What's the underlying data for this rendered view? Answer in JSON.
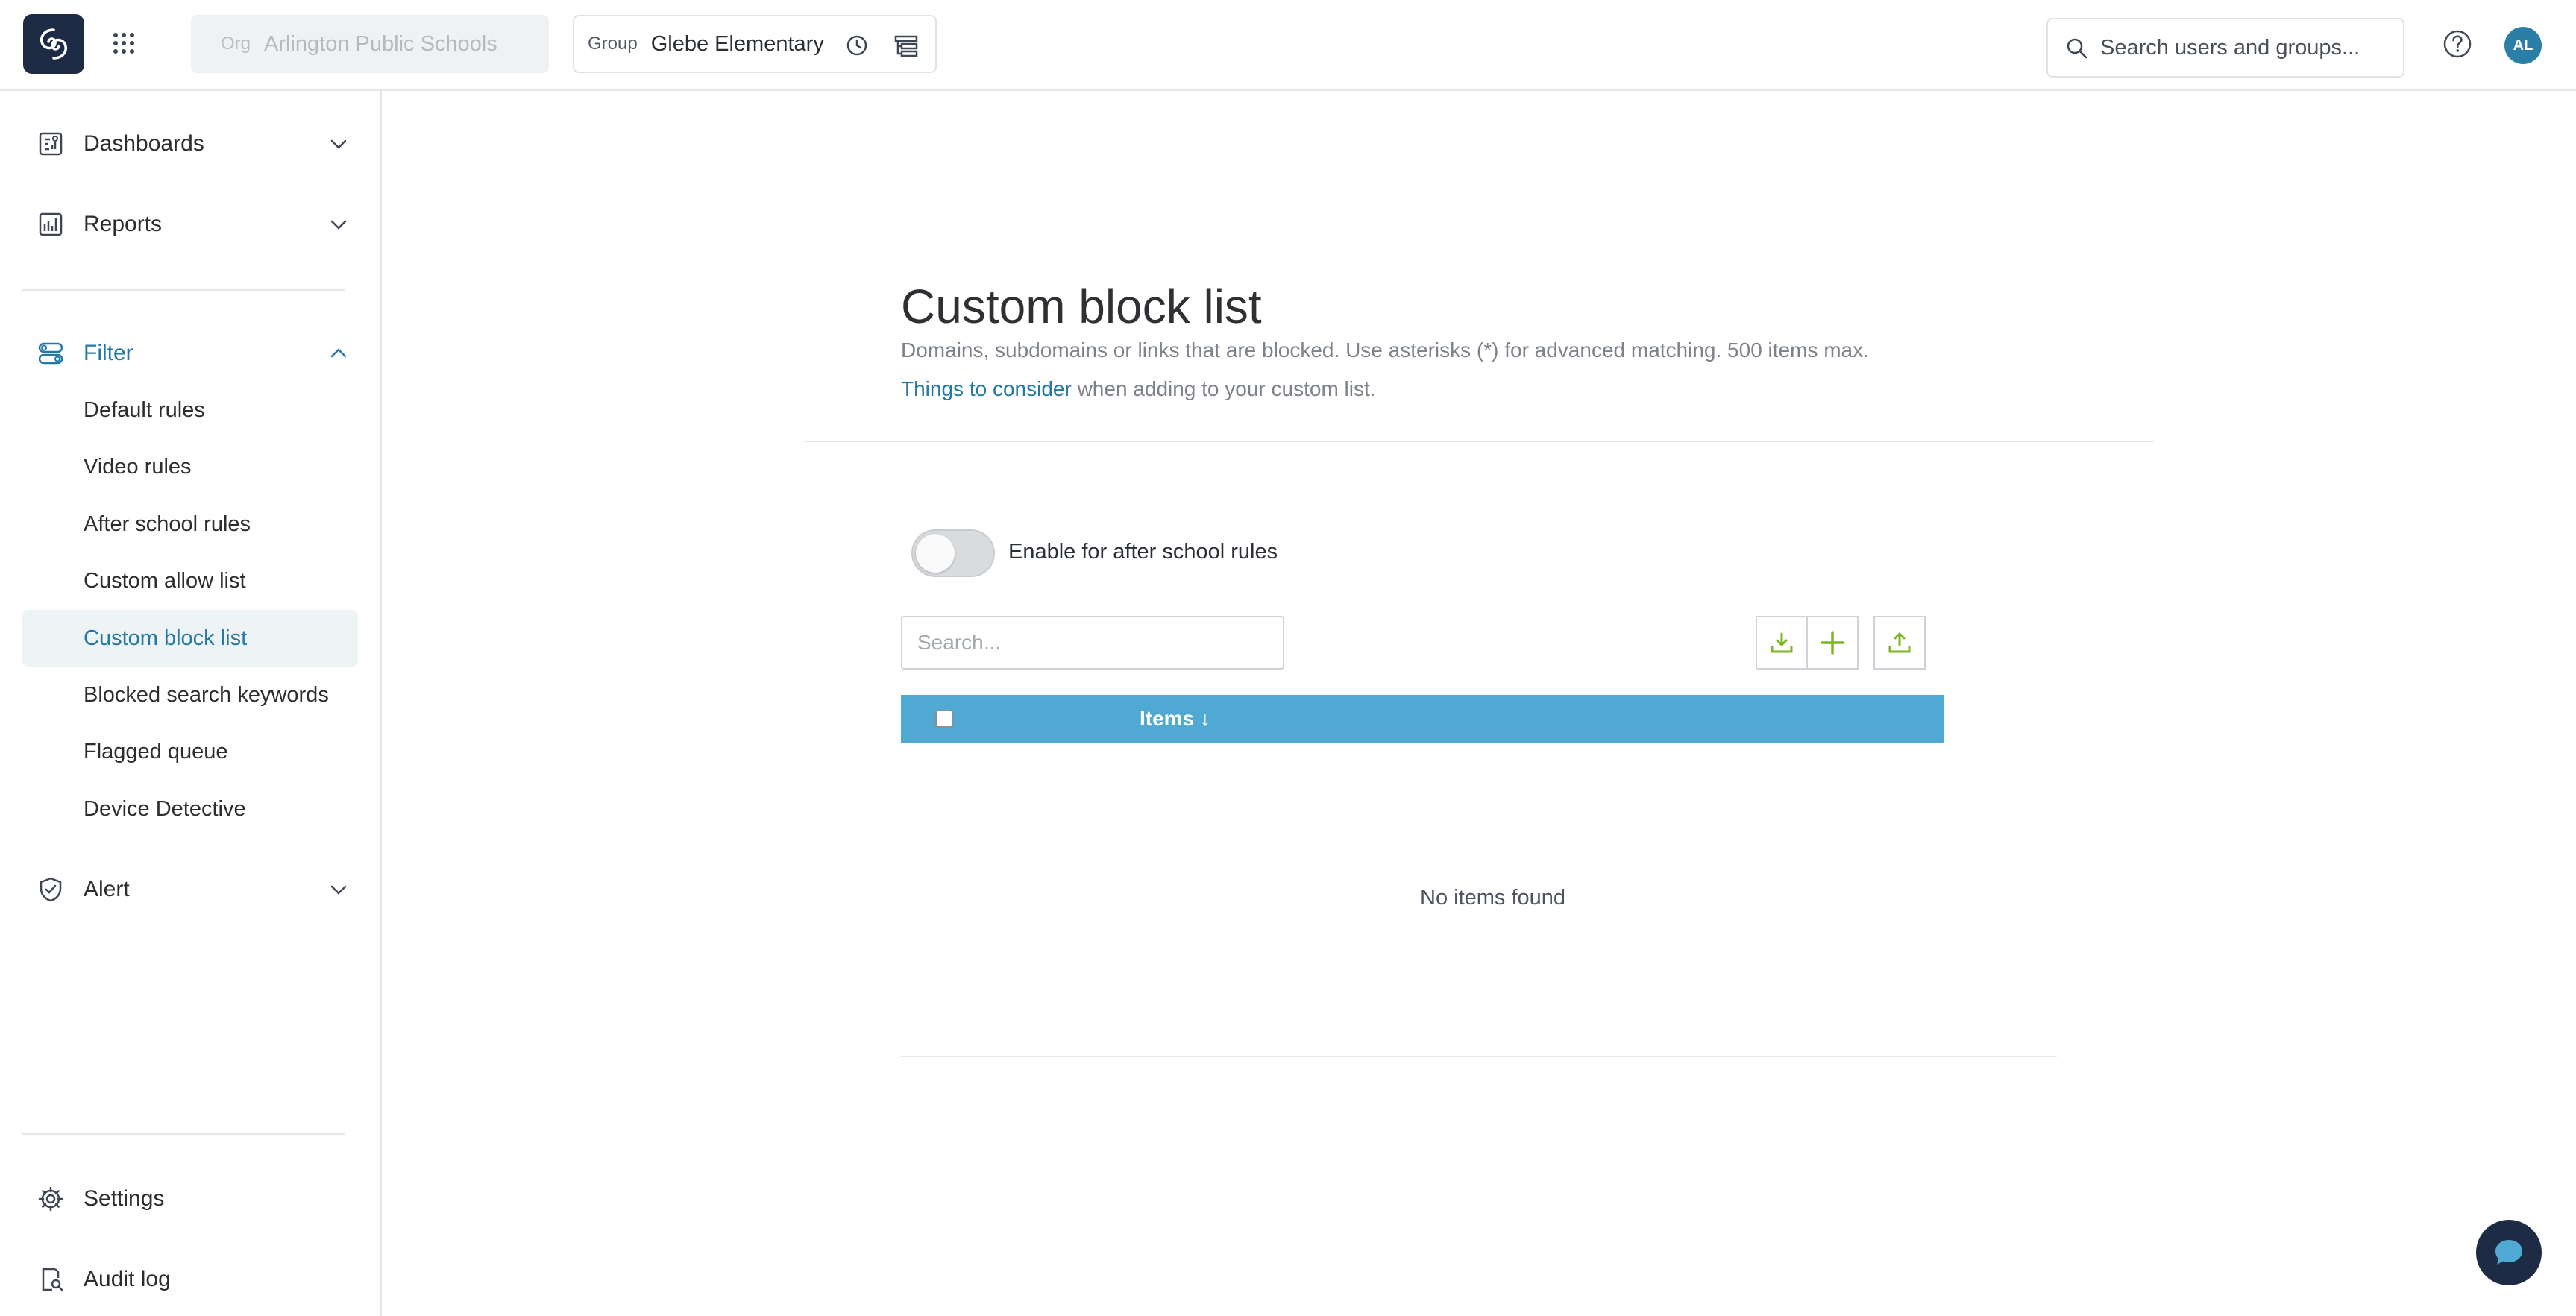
{
  "header": {
    "org_label": "Org",
    "org_value": "Arlington Public Schools",
    "group_label": "Group",
    "group_value": "Glebe Elementary",
    "search_placeholder": "Search users and groups...",
    "avatar_initials": "AL"
  },
  "sidebar": {
    "sections": {
      "dashboards": "Dashboards",
      "reports": "Reports",
      "filter": "Filter",
      "alert": "Alert",
      "settings": "Settings",
      "audit_log": "Audit log"
    },
    "filter_items": [
      {
        "label": "Default rules"
      },
      {
        "label": "Video rules"
      },
      {
        "label": "After school rules"
      },
      {
        "label": "Custom allow list"
      },
      {
        "label": "Custom block list"
      },
      {
        "label": "Blocked search keywords"
      },
      {
        "label": "Flagged queue"
      },
      {
        "label": "Device Detective"
      }
    ],
    "selected_item": "Custom block list"
  },
  "main": {
    "title": "Custom block list",
    "description": "Domains, subdomains or links that are blocked. Use asterisks (*) for advanced matching. 500 items max.",
    "consider_link": "Things to consider",
    "consider_suffix": " when adding to your custom list.",
    "toggle_label": "Enable for after school rules",
    "toggle_on": false,
    "list_search_placeholder": "Search...",
    "table_column": "Items ↓",
    "empty_message": "No items found"
  },
  "colors": {
    "accent": "#2479a3",
    "table_header": "#4fa9d3",
    "action_icon": "#7fb524",
    "brand_dark": "#1d2b45"
  }
}
